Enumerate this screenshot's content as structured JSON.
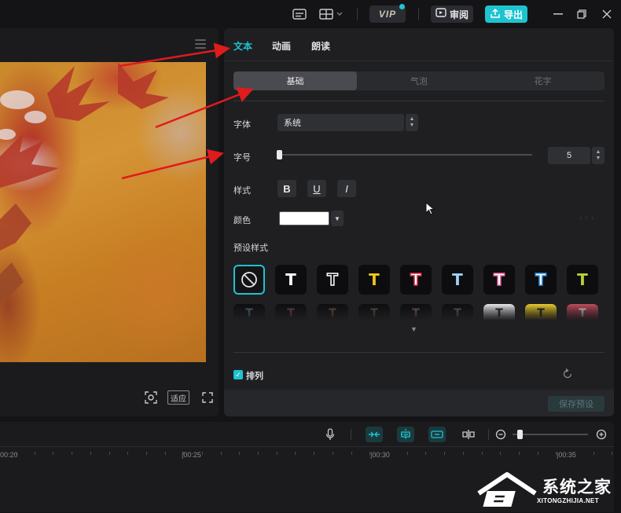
{
  "topbar": {
    "vip_label": "VIP",
    "review_label": "审阅",
    "export_label": "导出",
    "accent_color": "#1ec3d0"
  },
  "player": {
    "fit_label": "适应"
  },
  "panel": {
    "tabs": [
      {
        "label": "文本",
        "active": true
      },
      {
        "label": "动画",
        "active": false
      },
      {
        "label": "朗读",
        "active": false
      }
    ],
    "segments": [
      {
        "label": "基础",
        "active": true
      },
      {
        "label": "气泡",
        "active": false
      },
      {
        "label": "花字",
        "active": false
      }
    ],
    "font_label": "字体",
    "font_value": "系统",
    "size_label": "字号",
    "size_value": "5",
    "style_label": "样式",
    "style_buttons": [
      "B",
      "U",
      "I"
    ],
    "color_label": "颜色",
    "color_value": "#ffffff",
    "preset_label": "预设样式",
    "preset_row1": [
      "none",
      "T",
      "T",
      "T",
      "T",
      "T",
      "T",
      "T",
      "T"
    ],
    "arrange_label": "排列",
    "save_preset_label": "保存预设"
  },
  "timeline": {
    "ruler": [
      "00:20",
      "|00:25",
      "|00:30",
      "|00:35"
    ]
  },
  "watermark": {
    "title": "系统之家",
    "url": "XITONGZHIJIA.NET"
  }
}
